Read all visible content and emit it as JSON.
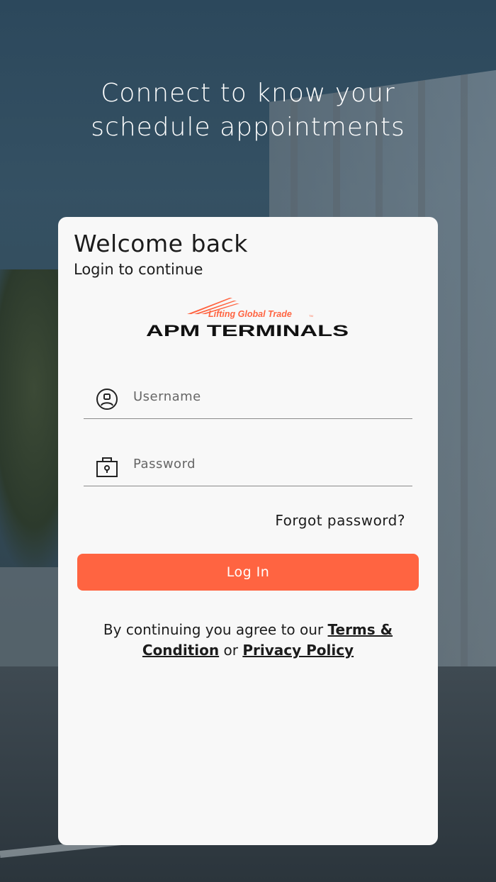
{
  "headline": {
    "line1": "Connect to know your",
    "line2": "schedule appointments"
  },
  "card": {
    "title": "Welcome back",
    "subtitle": "Login to continue"
  },
  "logo": {
    "tagline": "Lifting Global Trade",
    "tm": "TM",
    "brand": "APM TERMINALS",
    "accent_color": "#ff6441"
  },
  "form": {
    "username": {
      "value": "",
      "placeholder": "Username",
      "icon": "user-icon"
    },
    "password": {
      "value": "",
      "placeholder": "Password",
      "icon": "lock-icon"
    },
    "forgot_label": "Forgot password?",
    "login_label": "Log In"
  },
  "terms": {
    "prefix": "By continuing you agree to our ",
    "terms_link": "Terms & Condition",
    "middle": " or ",
    "privacy_link": "Privacy Policy"
  },
  "colors": {
    "primary_button": "#ff6441",
    "card_background": "#f8f8f8",
    "text": "#1c1c1c"
  }
}
